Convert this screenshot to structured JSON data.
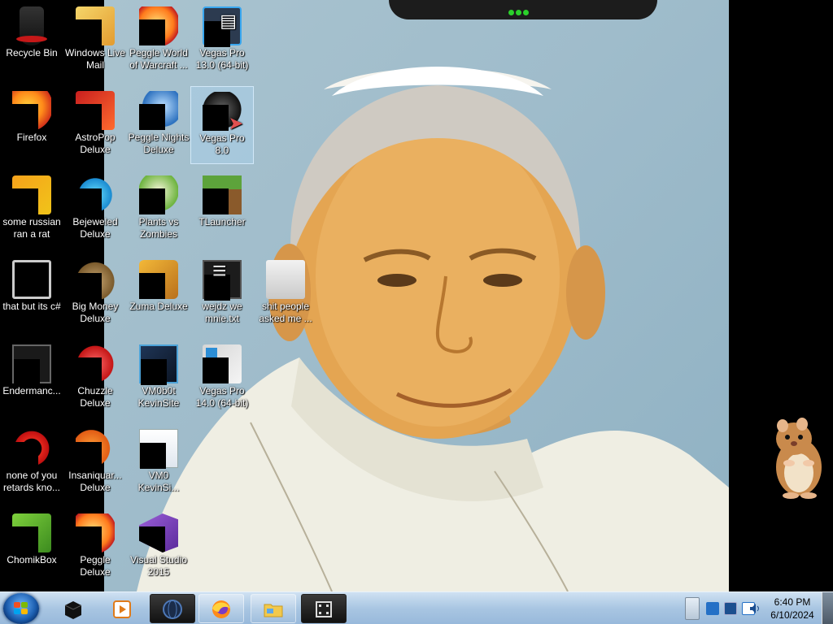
{
  "desktop": {
    "icons": [
      {
        "label": "Recycle Bin",
        "icon": "recycle-bin-icon"
      },
      {
        "label": "Windows Live Mail",
        "icon": "windows-live-mail-icon"
      },
      {
        "label": "Peggle World of Warcraft ...",
        "icon": "peggle-wow-icon"
      },
      {
        "label": "Vegas Pro 13.0 (64-bit)",
        "icon": "vegas-pro-13-icon"
      },
      {
        "label": "Firefox",
        "icon": "firefox-icon"
      },
      {
        "label": "AstroPop Deluxe",
        "icon": "astropop-icon"
      },
      {
        "label": "Peggle Nights Deluxe",
        "icon": "peggle-nights-icon"
      },
      {
        "label": "Vegas Pro 8.0",
        "icon": "vegas-pro-8-icon"
      },
      {
        "label": "some russian ran a rat",
        "icon": "eclipse-icon"
      },
      {
        "label": "Bejeweled Deluxe",
        "icon": "bejeweled-icon"
      },
      {
        "label": "Plants vs Zombies",
        "icon": "plants-vs-zombies-icon"
      },
      {
        "label": "TLauncher",
        "icon": "tlauncher-icon"
      },
      {
        "label": "that but its c#",
        "icon": "folder-shortcut-icon"
      },
      {
        "label": "Big Money Deluxe",
        "icon": "big-money-icon"
      },
      {
        "label": "Zuma Deluxe",
        "icon": "zuma-icon"
      },
      {
        "label": "wejdz we mnie.txt",
        "icon": "text-file-icon"
      },
      {
        "label": "shit people asked me ...",
        "icon": "folder-icon"
      },
      {
        "label": "Endermanc...",
        "icon": "enderman-icon"
      },
      {
        "label": "Chuzzle Deluxe",
        "icon": "chuzzle-icon"
      },
      {
        "label": "VM0b0t KevinSite",
        "icon": "vm-kevinsite-icon"
      },
      {
        "label": "Vegas Pro 14.0 (64-bit)",
        "icon": "vegas-pro-14-icon"
      },
      {
        "label": "none of you retards kno...",
        "icon": "opera-icon"
      },
      {
        "label": "Insaniquar... Deluxe",
        "icon": "insaniquarium-icon"
      },
      {
        "label": "VM0 KevinSi...",
        "icon": "file-icon"
      },
      {
        "label": "ChomikBox",
        "icon": "chomikbox-icon"
      },
      {
        "label": "Peggle Deluxe",
        "icon": "peggle-icon"
      },
      {
        "label": "Visual Studio 2015",
        "icon": "visual-studio-icon"
      }
    ],
    "selected_icon": "Vegas Pro 8.0"
  },
  "taskbar": {
    "start_icon": "windows-start-icon",
    "pinned": [
      {
        "name": "taskbar-black-app",
        "icon": "black-cube-icon"
      },
      {
        "name": "taskbar-media-player",
        "icon": "media-player-icon"
      },
      {
        "name": "taskbar-app-globe",
        "icon": "dark-globe-icon"
      },
      {
        "name": "taskbar-firefox",
        "icon": "firefox-icon"
      },
      {
        "name": "taskbar-explorer",
        "icon": "explorer-folder-icon"
      },
      {
        "name": "taskbar-vegas",
        "icon": "film-strip-icon"
      }
    ],
    "tray_icons": [
      "notification-arrow-icon",
      "tray-app-icon",
      "network-icon",
      "tray-monitor-icon",
      "volume-icon"
    ],
    "clock": {
      "time": "6:40 PM",
      "date": "6/10/2024"
    }
  },
  "colors": {
    "taskbar": "#a9c6e2",
    "wallpaper_sky": "#9fbccb",
    "selection": "#aad2f0"
  }
}
